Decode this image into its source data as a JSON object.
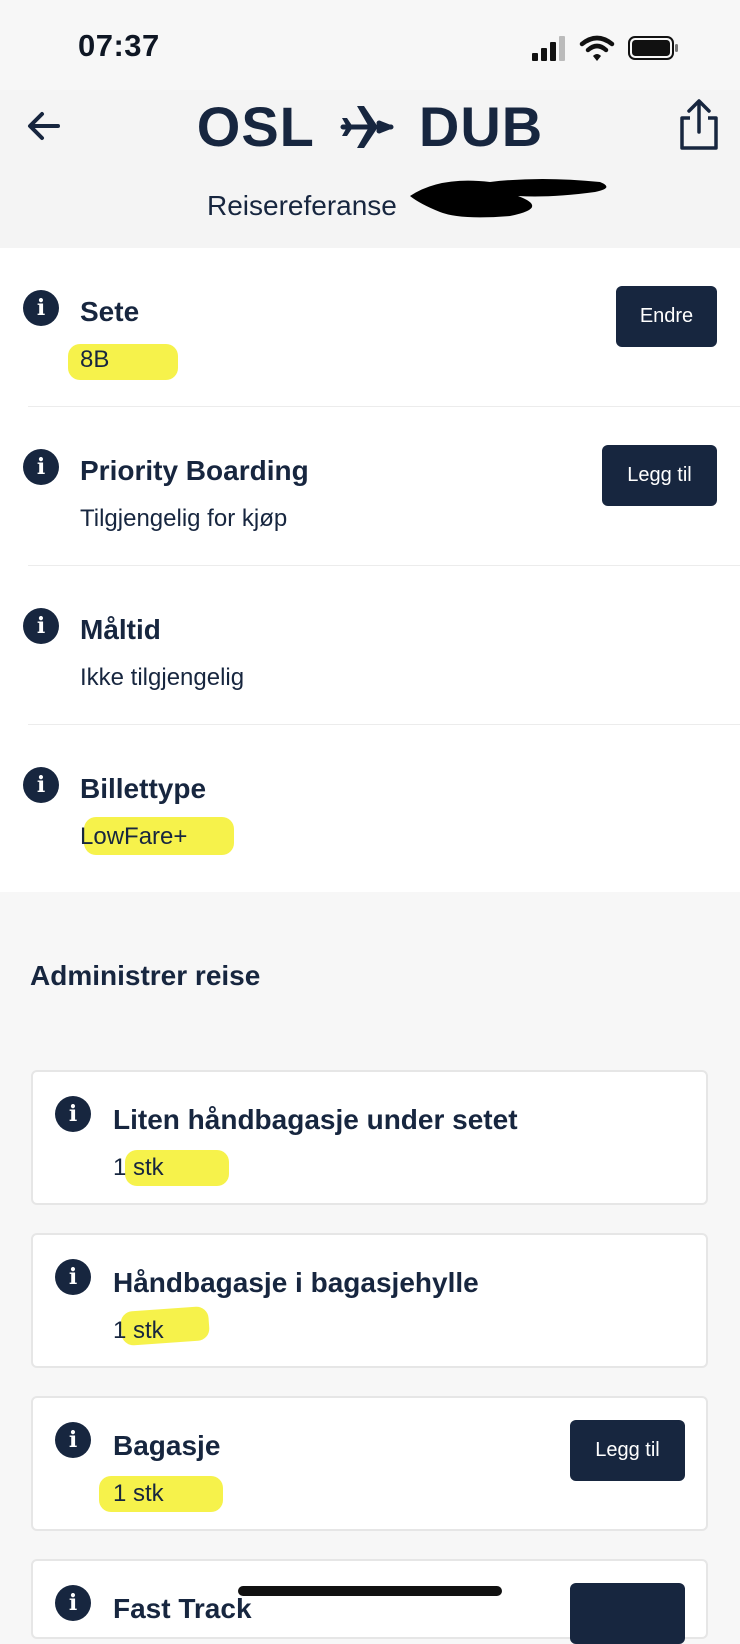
{
  "status_bar": {
    "time": "07:37"
  },
  "header": {
    "origin": "OSL",
    "destination": "DUB",
    "reference_label": "Reisereferanse"
  },
  "details": [
    {
      "title": "Sete",
      "value": "8B",
      "button": "Endre"
    },
    {
      "title": "Priority Boarding",
      "value": "Tilgjengelig for kjøp",
      "button": "Legg til"
    },
    {
      "title": "Måltid",
      "value": "Ikke tilgjengelig"
    },
    {
      "title": "Billettype",
      "value": "LowFare+"
    }
  ],
  "manage": {
    "title": "Administrer reise",
    "cards": [
      {
        "title": "Liten håndbagasje under setet",
        "value": "1 stk"
      },
      {
        "title": "Håndbagasje i bagasjehylle",
        "value": "1 stk"
      },
      {
        "title": "Bagasje",
        "value": "1 stk",
        "button": "Legg til"
      },
      {
        "title": "Fast Track"
      }
    ]
  },
  "colors": {
    "navy": "#17263f",
    "highlight": "#f4f02c",
    "background": "#f7f7f7"
  },
  "icons": [
    "cellular-signal-icon",
    "wifi-icon",
    "battery-icon",
    "back-arrow-icon",
    "share-icon",
    "airplane-icon",
    "info-icon"
  ]
}
